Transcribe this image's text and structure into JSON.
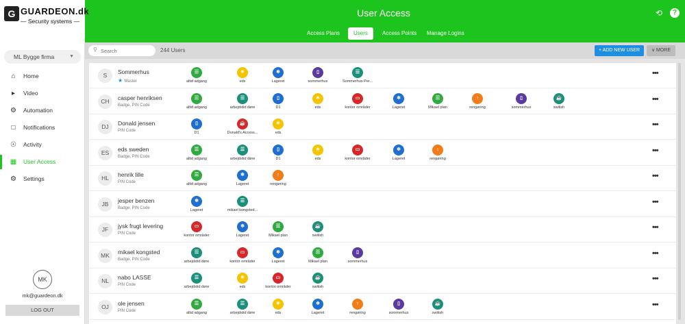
{
  "brand": {
    "name": "GUARDEON.dk",
    "tagline": "— Security systems —"
  },
  "header": {
    "title": "User Access",
    "tabs": [
      {
        "label": "Access Plans",
        "active": false
      },
      {
        "label": "Users",
        "active": true
      },
      {
        "label": "Access Points",
        "active": false
      },
      {
        "label": "Manage Logins",
        "active": false
      }
    ],
    "icons": [
      "refresh-icon",
      "help-icon"
    ]
  },
  "sidebar": {
    "company": "ML Bygge firma",
    "items": [
      {
        "label": "Home",
        "icon": "home-icon",
        "active": false
      },
      {
        "label": "Video",
        "icon": "video-icon",
        "active": false
      },
      {
        "label": "Automation",
        "icon": "automation-icon",
        "active": false
      },
      {
        "label": "Notifications",
        "icon": "notification-icon",
        "active": false
      },
      {
        "label": "Activity",
        "icon": "activity-icon",
        "active": false
      },
      {
        "label": "User Access",
        "icon": "user-access-icon",
        "active": true
      },
      {
        "label": "Settings",
        "icon": "gear-icon",
        "active": false
      }
    ],
    "avatar": "MK",
    "email": "mk@guardeon.dk",
    "logout": "LOG OUT"
  },
  "toolbar": {
    "search_placeholder": "Search",
    "count": "244 Users",
    "add_label": "+ ADD NEW USER",
    "more_label": "∨ MORE"
  },
  "colors": {
    "accent": "#1ec41e",
    "green": "#2eaa3f",
    "yellow": "#f5c400",
    "blue": "#1f6fd0",
    "purple": "#5b3aa0",
    "teal": "#1a8f7a",
    "red": "#d62828",
    "orange": "#f07c1a"
  },
  "users": [
    {
      "initials": "S",
      "name": "Sommerhus",
      "sub": "Master",
      "master": true,
      "access": [
        {
          "label": "altid adgang",
          "color": "green",
          "icon": "plan-icon"
        },
        {
          "label": "eds",
          "color": "yellow",
          "icon": "sun-icon"
        },
        {
          "label": "Lageret",
          "color": "blue",
          "icon": "fan-icon"
        },
        {
          "label": "sommerhus",
          "color": "purple",
          "icon": "door-icon"
        },
        {
          "label": "Sommerhus Per...",
          "color": "teal",
          "icon": "plan-icon"
        }
      ]
    },
    {
      "initials": "CH",
      "name": "casper henriksen",
      "sub": "Badge, PIN Code",
      "access": [
        {
          "label": "altid adgang",
          "color": "green",
          "icon": "plan-icon"
        },
        {
          "label": "arbejdstid døre",
          "color": "teal",
          "icon": "plan-icon"
        },
        {
          "label": "D1",
          "color": "blue",
          "icon": "door-icon"
        },
        {
          "label": "eds",
          "color": "yellow",
          "icon": "sun-icon"
        },
        {
          "label": "kontor områder",
          "color": "red",
          "icon": "monitor-icon"
        },
        {
          "label": "Lageret",
          "color": "blue",
          "icon": "fan-icon"
        },
        {
          "label": "Mikael plan",
          "color": "green",
          "icon": "plan-icon"
        },
        {
          "label": "rengøring",
          "color": "orange",
          "icon": "arrow-icon"
        },
        {
          "label": "sommerhus",
          "color": "purple",
          "icon": "door-icon"
        },
        {
          "label": "switish",
          "color": "teal",
          "icon": "cup-icon"
        }
      ]
    },
    {
      "initials": "DJ",
      "name": "Donald jensen",
      "sub": "PIN Code",
      "access": [
        {
          "label": "D1",
          "color": "blue",
          "icon": "door-icon"
        },
        {
          "label": "Donald's Access...",
          "color": "red",
          "icon": "cup-icon"
        },
        {
          "label": "eds",
          "color": "yellow",
          "icon": "sun-icon"
        }
      ]
    },
    {
      "initials": "ES",
      "name": "eds sweden",
      "sub": "Badge, PIN Code",
      "access": [
        {
          "label": "altid adgang",
          "color": "green",
          "icon": "plan-icon"
        },
        {
          "label": "arbejdstid døre",
          "color": "teal",
          "icon": "plan-icon"
        },
        {
          "label": "D1",
          "color": "blue",
          "icon": "door-icon"
        },
        {
          "label": "eds",
          "color": "yellow",
          "icon": "sun-icon"
        },
        {
          "label": "kontor områder",
          "color": "red",
          "icon": "monitor-icon"
        },
        {
          "label": "Lageret",
          "color": "blue",
          "icon": "fan-icon"
        },
        {
          "label": "rengøring",
          "color": "orange",
          "icon": "arrow-icon"
        }
      ]
    },
    {
      "initials": "HL",
      "name": "henrik lille",
      "sub": "PIN Code",
      "access": [
        {
          "label": "altid adgang",
          "color": "green",
          "icon": "plan-icon"
        },
        {
          "label": "Lageret",
          "color": "blue",
          "icon": "fan-icon"
        },
        {
          "label": "rengøring",
          "color": "orange",
          "icon": "arrow-icon"
        }
      ]
    },
    {
      "initials": "JB",
      "name": "jesper benzen",
      "sub": "Badge, PIN Code",
      "access": [
        {
          "label": "Lageret",
          "color": "blue",
          "icon": "fan-icon"
        },
        {
          "label": "mikael kongsted...",
          "color": "teal",
          "icon": "plan-icon"
        }
      ]
    },
    {
      "initials": "JF",
      "name": "jysk frugt levering",
      "sub": "PIN Code",
      "access": [
        {
          "label": "kontor områder",
          "color": "red",
          "icon": "monitor-icon"
        },
        {
          "label": "Lageret",
          "color": "blue",
          "icon": "fan-icon"
        },
        {
          "label": "Mikael plan",
          "color": "green",
          "icon": "plan-icon"
        },
        {
          "label": "switish",
          "color": "teal",
          "icon": "cup-icon"
        }
      ]
    },
    {
      "initials": "MK",
      "name": "mikael kongsted",
      "sub": "Badge, PIN Code",
      "access": [
        {
          "label": "arbejdstid døre",
          "color": "teal",
          "icon": "plan-icon"
        },
        {
          "label": "kontor områder",
          "color": "red",
          "icon": "monitor-icon"
        },
        {
          "label": "Lageret",
          "color": "blue",
          "icon": "fan-icon"
        },
        {
          "label": "Mikael plan",
          "color": "green",
          "icon": "plan-icon"
        },
        {
          "label": "sommerhus",
          "color": "purple",
          "icon": "door-icon"
        }
      ]
    },
    {
      "initials": "NL",
      "name": "nabo LASSE",
      "sub": "PIN Code",
      "access": [
        {
          "label": "arbejdstid døre",
          "color": "teal",
          "icon": "plan-icon"
        },
        {
          "label": "eds",
          "color": "yellow",
          "icon": "sun-icon"
        },
        {
          "label": "kontor områder",
          "color": "red",
          "icon": "monitor-icon"
        },
        {
          "label": "switish",
          "color": "teal",
          "icon": "cup-icon"
        }
      ]
    },
    {
      "initials": "OJ",
      "name": "ole jensen",
      "sub": "PIN Code",
      "access": [
        {
          "label": "altid adgang",
          "color": "green",
          "icon": "plan-icon"
        },
        {
          "label": "arbejdstid døre",
          "color": "teal",
          "icon": "plan-icon"
        },
        {
          "label": "eds",
          "color": "yellow",
          "icon": "sun-icon"
        },
        {
          "label": "Lageret",
          "color": "blue",
          "icon": "fan-icon"
        },
        {
          "label": "rengøring",
          "color": "orange",
          "icon": "arrow-icon"
        },
        {
          "label": "sommerhus",
          "color": "purple",
          "icon": "door-icon"
        },
        {
          "label": "switish",
          "color": "teal",
          "icon": "cup-icon"
        }
      ]
    }
  ]
}
